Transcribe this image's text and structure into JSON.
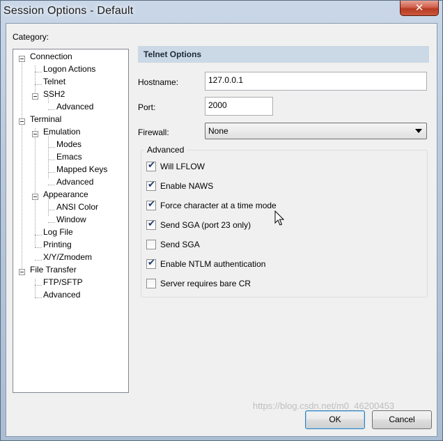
{
  "window": {
    "title": "Session Options - Default",
    "close_glyph": "✕"
  },
  "category_label": "Category:",
  "tree": [
    {
      "label": "Connection",
      "name": "tree-item-connection",
      "expanded": true
    },
    {
      "label": "Logon Actions",
      "name": "tree-item-logon-actions"
    },
    {
      "label": "Telnet",
      "name": "tree-item-telnet",
      "selected": true
    },
    {
      "label": "SSH2",
      "name": "tree-item-ssh2",
      "expanded": true
    },
    {
      "label": "Advanced",
      "name": "tree-item-ssh2-advanced"
    },
    {
      "label": "Terminal",
      "name": "tree-item-terminal",
      "expanded": true
    },
    {
      "label": "Emulation",
      "name": "tree-item-emulation",
      "expanded": true
    },
    {
      "label": "Modes",
      "name": "tree-item-modes"
    },
    {
      "label": "Emacs",
      "name": "tree-item-emacs"
    },
    {
      "label": "Mapped Keys",
      "name": "tree-item-mapped-keys"
    },
    {
      "label": "Advanced",
      "name": "tree-item-emulation-advanced"
    },
    {
      "label": "Appearance",
      "name": "tree-item-appearance",
      "expanded": true
    },
    {
      "label": "ANSI Color",
      "name": "tree-item-ansi-color"
    },
    {
      "label": "Window",
      "name": "tree-item-window"
    },
    {
      "label": "Log File",
      "name": "tree-item-log-file"
    },
    {
      "label": "Printing",
      "name": "tree-item-printing"
    },
    {
      "label": "X/Y/Zmodem",
      "name": "tree-item-xyzmodem"
    },
    {
      "label": "File Transfer",
      "name": "tree-item-file-transfer",
      "expanded": true
    },
    {
      "label": "FTP/SFTP",
      "name": "tree-item-ftp-sftp"
    },
    {
      "label": "Advanced",
      "name": "tree-item-file-transfer-advanced"
    }
  ],
  "panel": {
    "header": "Telnet Options",
    "hostname_label": "Hostname:",
    "hostname_value": "127.0.0.1",
    "port_label": "Port:",
    "port_value": "2000",
    "firewall_label": "Firewall:",
    "firewall_value": "None",
    "advanced_title": "Advanced"
  },
  "options": [
    {
      "label": "Will LFLOW",
      "checked": true
    },
    {
      "label": "Enable NAWS",
      "checked": true
    },
    {
      "label": "Force character at a time mode",
      "checked": true
    },
    {
      "label": "Send SGA (port 23 only)",
      "checked": true
    },
    {
      "label": "Send SGA",
      "checked": false
    },
    {
      "label": "Enable NTLM authentication",
      "checked": true
    },
    {
      "label": "Server requires bare CR",
      "checked": false
    }
  ],
  "buttons": {
    "ok": "OK",
    "cancel": "Cancel"
  },
  "watermark": "https://blog.csdn.net/m0_46200453"
}
